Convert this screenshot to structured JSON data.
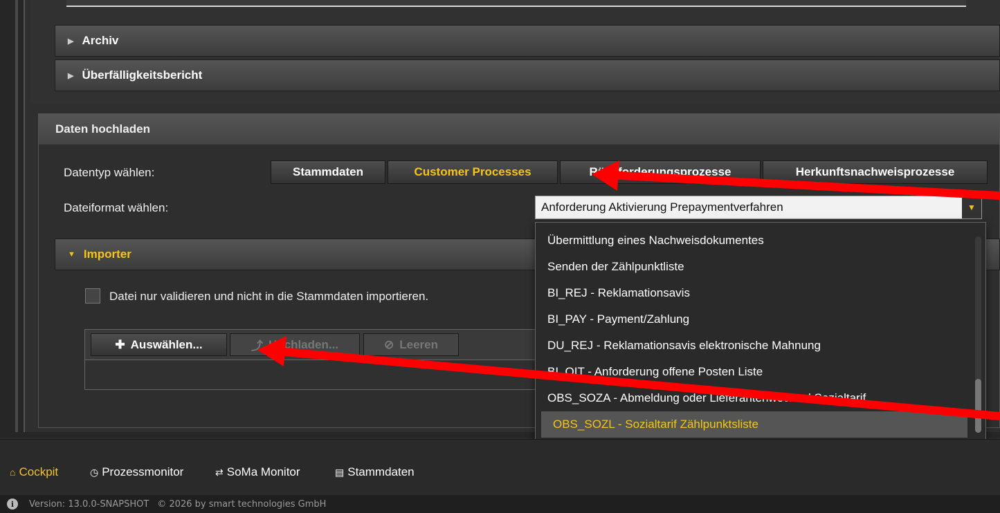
{
  "sections": {
    "archiv": "Archiv",
    "overdue": "Überfälligkeitsbericht",
    "upload_title": "Daten hochladen"
  },
  "upload": {
    "datatype_label": "Datentyp wählen:",
    "fileformat_label": "Dateiformat wählen:",
    "tabs": [
      {
        "label": "Stammdaten",
        "active": false
      },
      {
        "label": "Customer Processes",
        "active": true
      },
      {
        "label": "Rückforderungsprozesse",
        "active": false
      },
      {
        "label": "Herkunftsnachweisprozesse",
        "active": false
      }
    ],
    "fileformat_selected": "Anforderung Aktivierung Prepaymentverfahren",
    "dropdown_options": [
      "Übermittlung eines Nachweisdokumentes",
      "Senden der Zählpunktliste",
      "BI_REJ - Reklamationsavis",
      "BI_PAY - Payment/Zahlung",
      "DU_REJ - Reklamationsavis elektronische Mahnung",
      "BI_OIT - Anforderung offene Posten Liste",
      "OBS_SOZA - Abmeldung oder Lieferantenwechsel Sozialtarif",
      "OBS_SOZL - Sozialtarif Zählpunktsliste"
    ],
    "selected_option_index": 7
  },
  "importer": {
    "title": "Importer",
    "validate_label": "Datei nur validieren und nicht in die Stammdaten importieren.",
    "select_button": "Auswählen...",
    "upload_button": "Hochladen...",
    "clear_button": "Leeren"
  },
  "footer": {
    "nav": [
      {
        "label": "Cockpit",
        "icon": "home-icon",
        "active": true
      },
      {
        "label": "Prozessmonitor",
        "icon": "clock-icon",
        "active": false
      },
      {
        "label": "SoMa Monitor",
        "icon": "exchange-icon",
        "active": false
      },
      {
        "label": "Stammdaten",
        "icon": "database-icon",
        "active": false
      }
    ],
    "version": "Version: 13.0.0-SNAPSHOT",
    "copyright": "© 2026 by smart technologies GmbH"
  },
  "colors": {
    "accent": "#f5c518",
    "annotation_arrow": "#ff0000"
  }
}
